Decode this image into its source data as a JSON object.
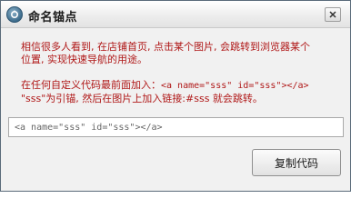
{
  "window": {
    "title": "命名锚点",
    "icon": "app-icon",
    "close_icon": "close-icon"
  },
  "content": {
    "line1": "相信很多人看到, 在店铺首页, 点击某个图片, 会跳转到浏览器某个",
    "line2": "位置, 实现快速导航的用途。",
    "line3_prefix": "在任何自定义代码最前面加入：",
    "line3_code": "<a name=\"sss\" id=\"sss\"></a>",
    "line4": "\"sss\"为引锚, 然后在图片上加入链接:#sss 就会跳转。"
  },
  "code_field": {
    "value": "<a name=\"sss\" id=\"sss\"></a>"
  },
  "actions": {
    "copy_label": "复制代码"
  },
  "colors": {
    "message_text": "#b01818",
    "dialog_bg": "#f1f1f1"
  }
}
